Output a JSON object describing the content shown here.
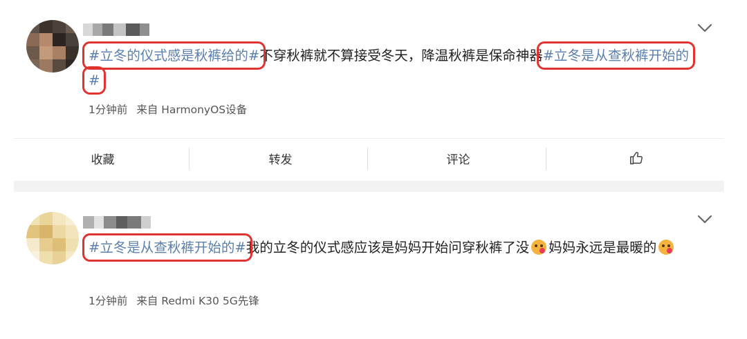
{
  "posts": [
    {
      "content": {
        "topic1": "#立冬的仪式感是秋裤给的#",
        "text1": "不穿秋裤就不算接受冬天，降温秋裤是保命神器",
        "topic2": "#立冬是从查秋裤开始的#"
      },
      "meta": {
        "time": "1分钟前",
        "source": "来自 HarmonyOS设备"
      },
      "actions": {
        "favorite": "收藏",
        "repost": "转发",
        "comment": "评论"
      },
      "icons": {
        "like": "thumbs-up-icon",
        "menu": "chevron-down-icon",
        "avatar": "blurred-avatar"
      }
    },
    {
      "content": {
        "topic1": "#立冬是从查秋裤开始的#",
        "text1": "我的立冬的仪式感应该是妈妈开始问穿秋裤了没",
        "text2": "妈妈永远是最暖的"
      },
      "meta": {
        "time": "1分钟前",
        "source": "来自 Redmi K30 5G先锋"
      },
      "icons": {
        "emoji": "blush-emoji-icon",
        "menu": "chevron-down-icon",
        "avatar": "blurred-avatar"
      }
    }
  ],
  "colors": {
    "topic": "#5b7fae",
    "highlight_box": "#e0332f",
    "text": "#222222",
    "meta": "#555555",
    "separator": "#f2f2f2"
  }
}
